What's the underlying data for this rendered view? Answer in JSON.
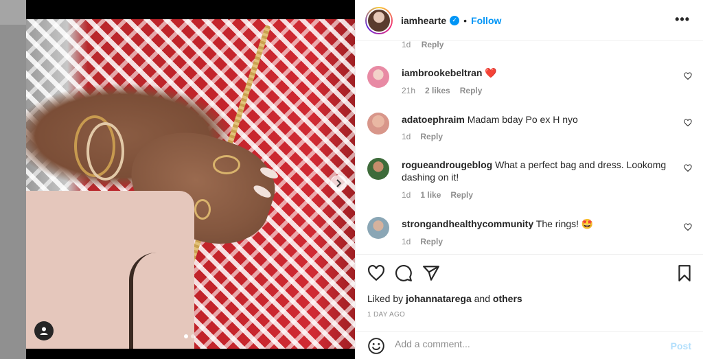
{
  "post": {
    "author": "iamhearte",
    "follow_label": "Follow",
    "separator": "•",
    "more_label": "•••",
    "media_slides": 2,
    "active_slide": 1
  },
  "partial_comment": {
    "time": "1d",
    "reply_label": "Reply"
  },
  "comments": [
    {
      "username": "iambrookebeltran",
      "text": "",
      "emoji": "❤️",
      "time": "21h",
      "likes": "2 likes",
      "reply_label": "Reply"
    },
    {
      "username": "adatoephraim",
      "text": "Madam bday Po ex H nyo",
      "emoji": "",
      "time": "1d",
      "likes": "",
      "reply_label": "Reply"
    },
    {
      "username": "rogueandrougeblog",
      "text": "What a perfect bag and dress. Lookomg dashing on it!",
      "emoji": "",
      "time": "1d",
      "likes": "1 like",
      "reply_label": "Reply"
    },
    {
      "username": "strongandhealthycommunity",
      "text": "The rings!",
      "emoji": "🤩",
      "time": "1d",
      "likes": "",
      "reply_label": "Reply"
    }
  ],
  "likes": {
    "prefix": "Liked by",
    "user": "johannatarega",
    "conjunction": "and",
    "others": "others"
  },
  "timestamp": "1 DAY AGO",
  "add_comment": {
    "placeholder": "Add a comment...",
    "post_label": "Post"
  },
  "colors": {
    "accent": "#0095f6",
    "post_disabled": "#b2dffc",
    "heart_red": "#ed4956"
  },
  "icons": {
    "like": "heart-icon",
    "comment": "comment-icon",
    "share": "share-icon",
    "save": "bookmark-icon",
    "emoji": "emoji-icon",
    "next": "chevron-right-icon",
    "tag": "user-tag-icon",
    "verified": "verified-badge-icon"
  }
}
